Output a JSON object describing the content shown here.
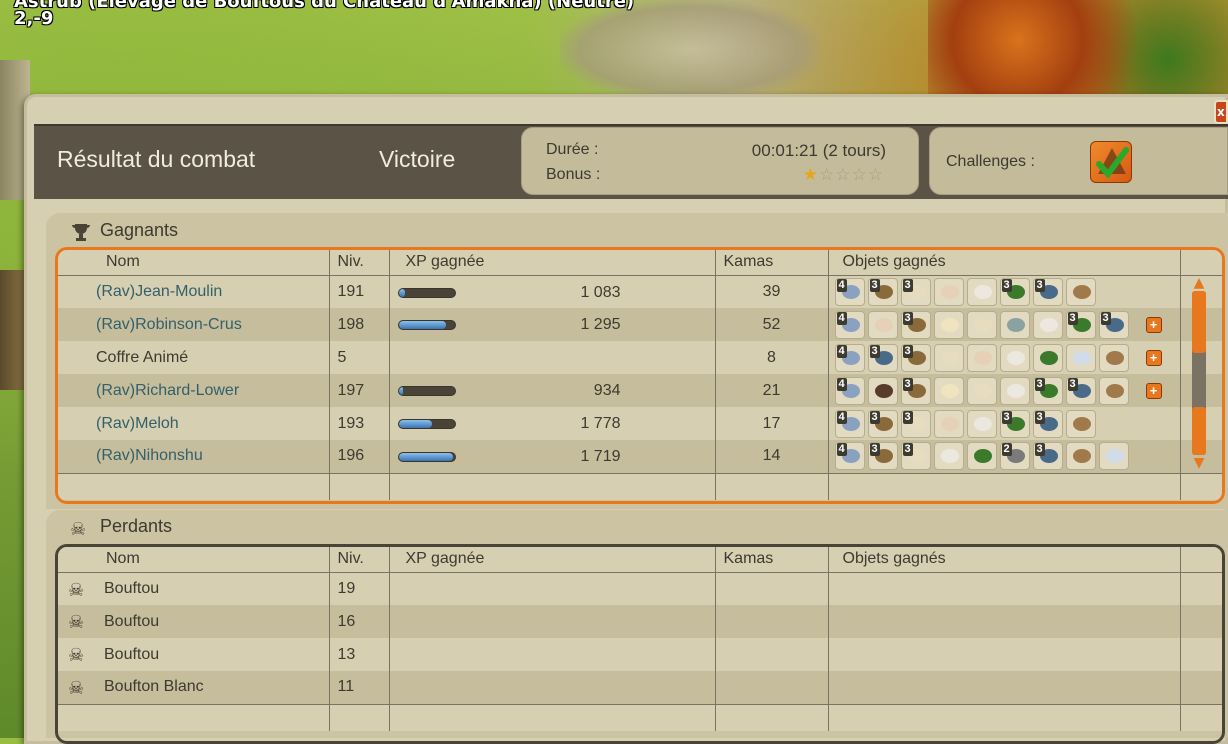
{
  "map": {
    "title": "Astrub (Élevage de Bouftous du Château d'Amakna) (Neutre)",
    "coords": "2,-9"
  },
  "window": {
    "title": "Résultat du combat",
    "result": "Victoire",
    "duration_label": "Durée :",
    "duration_value": "00:01:21 (2 tours)",
    "bonus_label": "Bonus :",
    "bonus_stars": 1,
    "bonus_stars_max": 5,
    "challenges_label": "Challenges :",
    "close_label": "x"
  },
  "columns": {
    "name": "Nom",
    "level": "Niv.",
    "xp": "XP gagnée",
    "kamas": "Kamas",
    "items": "Objets gagnés"
  },
  "winners": {
    "label": "Gagnants",
    "rows": [
      {
        "name": "(Rav)Jean-Moulin",
        "level": "191",
        "xp": "1 083",
        "xp_progress": 0.12,
        "kamas": "39",
        "items": [
          [
            "4",
            "#8aa2c0"
          ],
          [
            "3",
            "#8a6a3a"
          ],
          [
            "3",
            "#e8dcc0"
          ],
          [
            "",
            "#e6d0b8"
          ],
          [
            "",
            "#ece8e0"
          ],
          [
            "3",
            "#3a7a2a"
          ],
          [
            "3",
            "#4a6a8a"
          ],
          [
            "",
            "#a07a4a"
          ]
        ],
        "more": false,
        "link": true
      },
      {
        "name": "(Rav)Robinson-Crus",
        "level": "198",
        "xp": "1 295",
        "xp_progress": 0.85,
        "kamas": "52",
        "items": [
          [
            "4",
            "#8aa2c0"
          ],
          [
            "",
            "#e6d0b8"
          ],
          [
            "3",
            "#8a6a3a"
          ],
          [
            "",
            "#f0e4c0"
          ],
          [
            "",
            "#e8dcc0"
          ],
          [
            "",
            "#8aa2a0"
          ],
          [
            "",
            "#ece8e0"
          ],
          [
            "3",
            "#3a7a2a"
          ],
          [
            "3",
            "#4a6a8a"
          ]
        ],
        "more": true,
        "link": true
      },
      {
        "name": "Coffre Animé",
        "level": "5",
        "xp": "",
        "xp_progress": null,
        "kamas": "8",
        "items": [
          [
            "4",
            "#8aa2c0"
          ],
          [
            "3",
            "#4a6a8a"
          ],
          [
            "3",
            "#8a6a3a"
          ],
          [
            "",
            "#e8dcc0"
          ],
          [
            "",
            "#e6d0b8"
          ],
          [
            "",
            "#ece8e0"
          ],
          [
            "",
            "#3a7a2a"
          ],
          [
            "",
            "#d0dce8"
          ],
          [
            "",
            "#a07a4a"
          ]
        ],
        "more": true,
        "link": false
      },
      {
        "name": "(Rav)Richard-Lower",
        "level": "197",
        "xp": "934",
        "xp_progress": 0.08,
        "kamas": "21",
        "items": [
          [
            "4",
            "#8aa2c0"
          ],
          [
            "",
            "#5a3a2a"
          ],
          [
            "3",
            "#8a6a3a"
          ],
          [
            "",
            "#f0e4c0"
          ],
          [
            "",
            "#e8dcc0"
          ],
          [
            "",
            "#ece8e0"
          ],
          [
            "3",
            "#3a7a2a"
          ],
          [
            "3",
            "#4a6a8a"
          ],
          [
            "",
            "#a07a4a"
          ]
        ],
        "more": true,
        "link": true
      },
      {
        "name": "(Rav)Meloh",
        "level": "193",
        "xp": "1 778",
        "xp_progress": 0.6,
        "kamas": "17",
        "items": [
          [
            "4",
            "#8aa2c0"
          ],
          [
            "3",
            "#8a6a3a"
          ],
          [
            "3",
            "#e8dcc0"
          ],
          [
            "",
            "#e6d0b8"
          ],
          [
            "",
            "#ece8e0"
          ],
          [
            "3",
            "#3a7a2a"
          ],
          [
            "3",
            "#4a6a8a"
          ],
          [
            "",
            "#a07a4a"
          ]
        ],
        "more": false,
        "link": true
      },
      {
        "name": "(Rav)Nihonshu",
        "level": "196",
        "xp": "1 719",
        "xp_progress": 0.97,
        "kamas": "14",
        "items": [
          [
            "4",
            "#8aa2c0"
          ],
          [
            "3",
            "#8a6a3a"
          ],
          [
            "3",
            "#e8dcc0"
          ],
          [
            "",
            "#ece8e0"
          ],
          [
            "",
            "#3a7a2a"
          ],
          [
            "2",
            "#7a7a7a"
          ],
          [
            "3",
            "#4a6a8a"
          ],
          [
            "",
            "#a07a4a"
          ],
          [
            "",
            "#d0dce8"
          ]
        ],
        "more": false,
        "link": true
      }
    ]
  },
  "losers": {
    "label": "Perdants",
    "rows": [
      {
        "name": "Bouftou",
        "level": "19"
      },
      {
        "name": "Bouftou",
        "level": "16"
      },
      {
        "name": "Bouftou",
        "level": "13"
      },
      {
        "name": "Boufton Blanc",
        "level": "11"
      }
    ]
  },
  "colors": {
    "accent": "#e8781e",
    "link": "#33606a",
    "panel": "#d7cfb1",
    "header": "#5a5346"
  },
  "icons": {
    "trophy": "trophy-icon",
    "skull": "skull-icon",
    "challenge": "challenge-check-icon",
    "plus": "plus-icon"
  }
}
